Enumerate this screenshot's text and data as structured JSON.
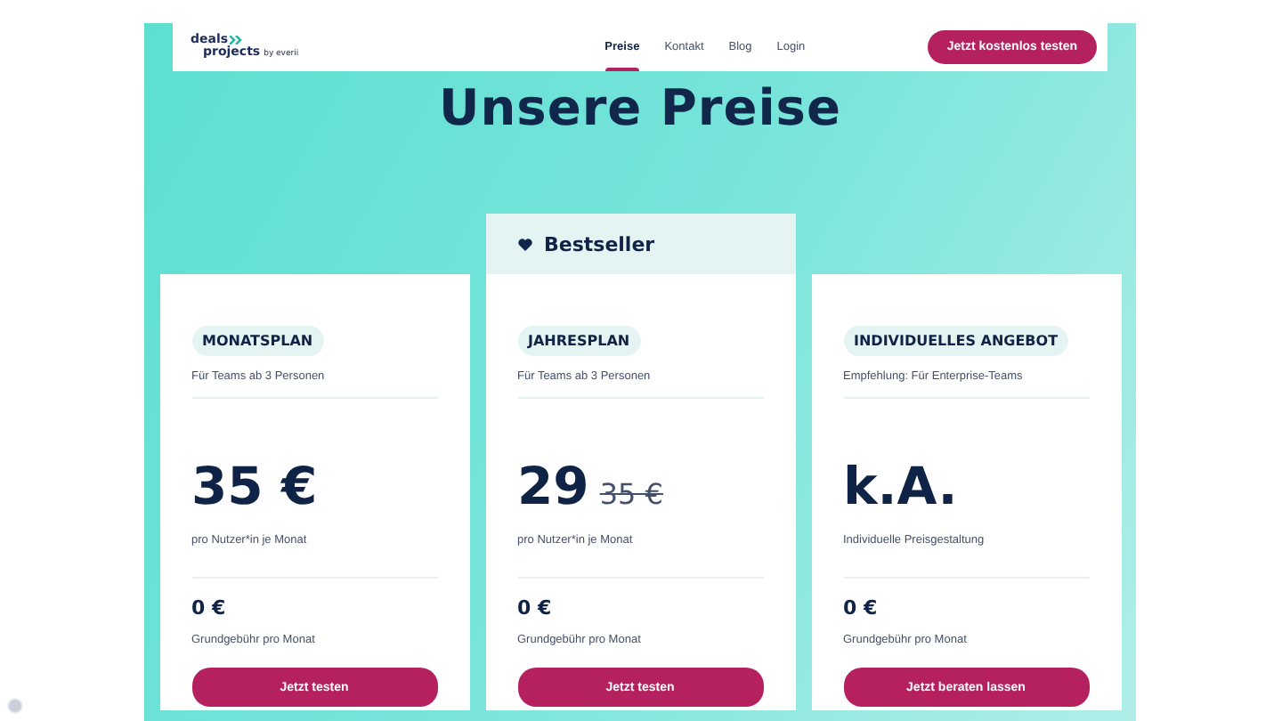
{
  "header": {
    "logo": {
      "line1": "deals",
      "line2": "projects",
      "tagline": "by everii"
    },
    "nav": [
      {
        "label": "Preise",
        "selected": true
      },
      {
        "label": "Kontakt",
        "selected": false
      },
      {
        "label": "Blog",
        "selected": false
      },
      {
        "label": "Login",
        "selected": false
      }
    ],
    "cta": "Jetzt kostenlos testen"
  },
  "title": "Unsere Preise",
  "plans": [
    {
      "name": "MONATSPLAN",
      "subtitle": "Für Teams ab 3 Personen",
      "price": "35 €",
      "price_note": "pro Nutzer*in je Monat",
      "base_fee": "0 €",
      "base_fee_note": "Grundgebühr pro Monat",
      "button": "Jetzt testen"
    },
    {
      "highlight": "Bestseller",
      "name": "JAHRESPLAN",
      "subtitle": "Für Teams ab 3 Personen",
      "price": "29",
      "old_price": "35 €",
      "price_note": "pro Nutzer*in je Monat",
      "base_fee": "0 €",
      "base_fee_note": "Grundgebühr pro Monat",
      "button": "Jetzt testen"
    },
    {
      "name": "INDIVIDUELLES ANGEBOT",
      "subtitle": "Empfehlung: Für Enterprise-Teams",
      "price": "k.A.",
      "price_note": "Individuelle Preisgestaltung",
      "base_fee": "0 €",
      "base_fee_note": "Grundgebühr pro Monat",
      "button": "Jetzt beraten lassen"
    }
  ]
}
